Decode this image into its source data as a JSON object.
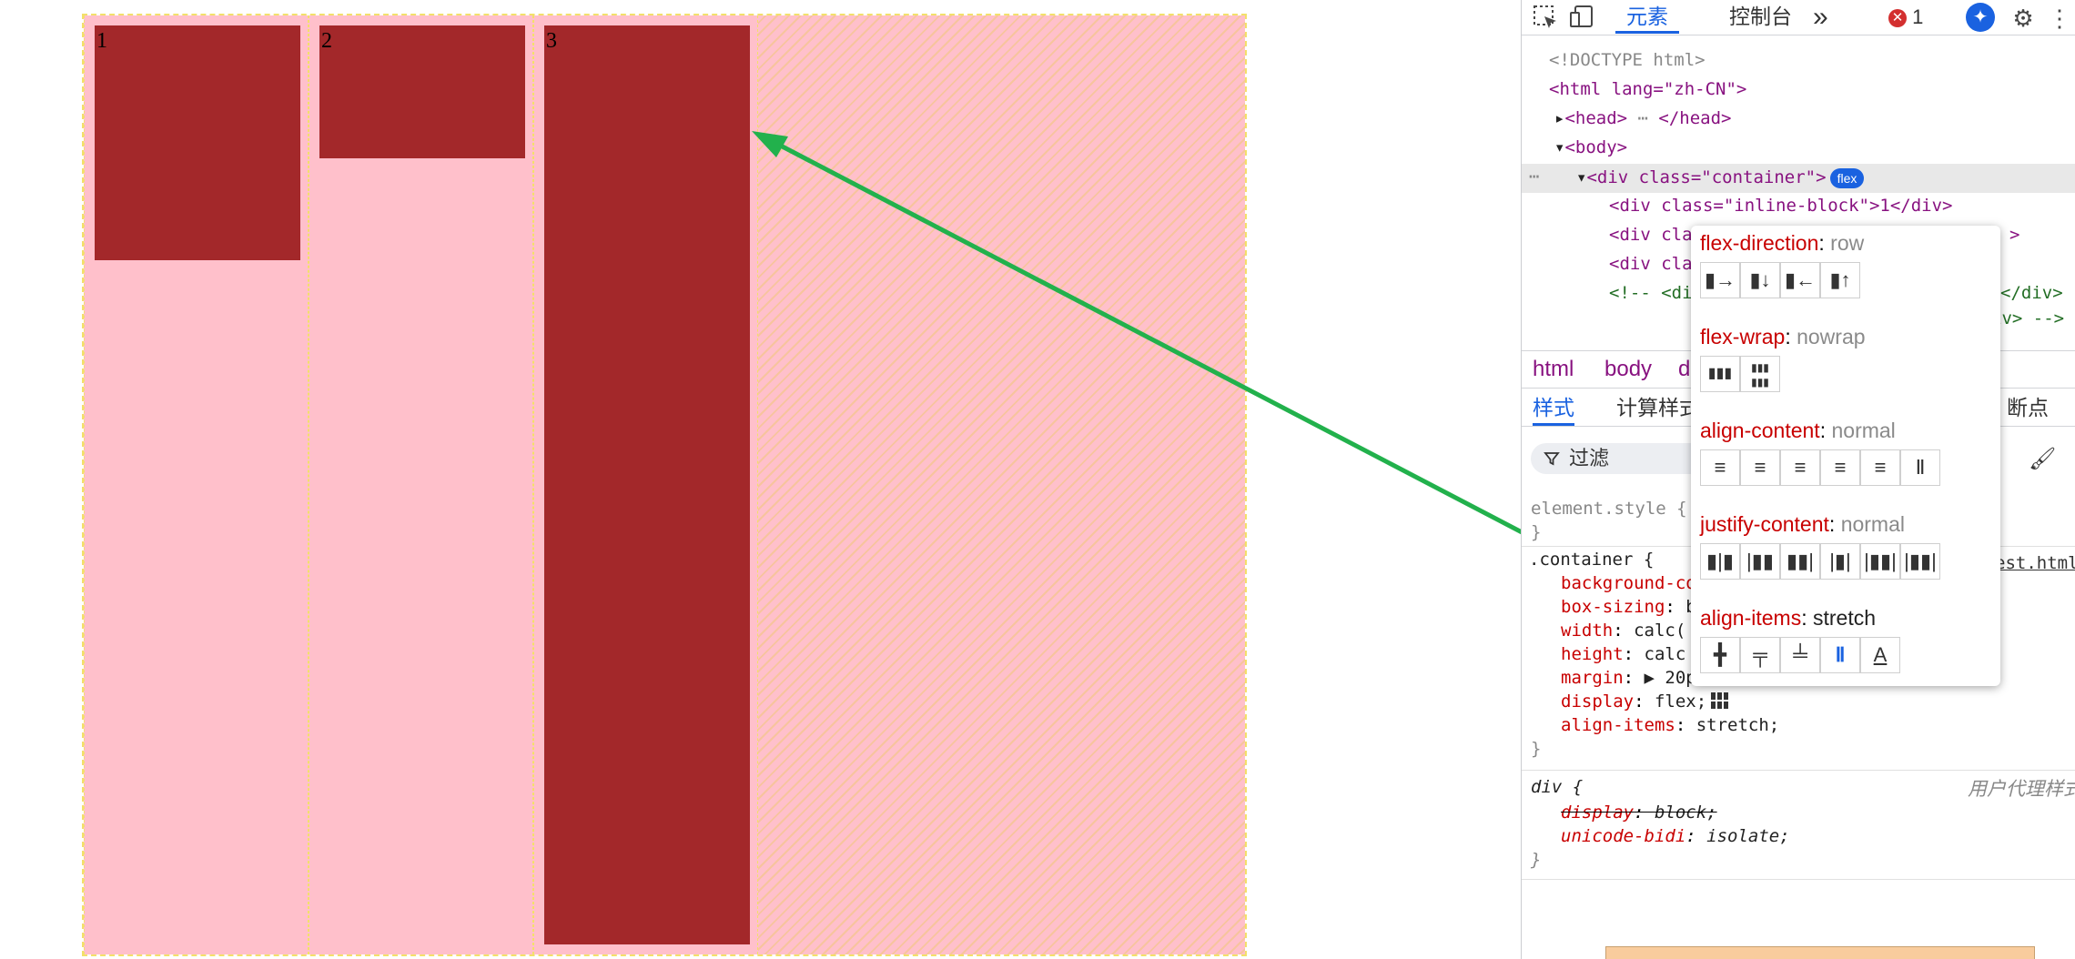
{
  "preview": {
    "items": [
      {
        "label": "1"
      },
      {
        "label": "2"
      },
      {
        "label": "3"
      }
    ],
    "colors": {
      "container_bg": "#ffc0cb",
      "item_bg": "#a3282a",
      "arrow": "#22b14c"
    }
  },
  "devtools": {
    "toolbar": {
      "tabs": [
        "元素",
        "控制台"
      ],
      "active_tab": "元素",
      "more_label": "»",
      "error_count": "1"
    },
    "dom": {
      "doctype": "<!DOCTYPE html>",
      "html_open": "<html lang=\"zh-CN\">",
      "head": "<head>",
      "head_close": "</head>",
      "body": "<body>",
      "container_line": "<div class=\"container\">",
      "flex_badge": "flex",
      "child1": "<div class=\"inline-block\">1</div>",
      "child2": "<div cla",
      "child3": "<div cla",
      "comment": "<!-- <di",
      "close_div_tail": "</div>",
      "comment_tail": "iv> -->",
      "div_close": "</div>",
      "child2_tail": ">"
    },
    "breadcrumbs": [
      "html",
      "body",
      "d"
    ],
    "subtabs": [
      "样式",
      "计算样式",
      "断点"
    ],
    "filter_placeholder": "过滤",
    "styles": {
      "element_style": "element.style {",
      "close_brace": "}",
      "container_selector": ".container {",
      "source_link": "est.html",
      "props": [
        {
          "name": "background-co",
          "value": ""
        },
        {
          "name": "box-sizing",
          "value": "b"
        },
        {
          "name": "width",
          "value": "calc("
        },
        {
          "name": "height",
          "value": "calc"
        },
        {
          "name": "margin",
          "value": "▶ 20p"
        },
        {
          "name": "display",
          "value": "flex;"
        },
        {
          "name": "align-items",
          "value": "stretch;"
        }
      ],
      "ua_selector": "div {",
      "ua_label": "用户代理样式",
      "ua_props": [
        {
          "name": "display",
          "value": "block;"
        },
        {
          "name": "unicode-bidi",
          "value": "isolate;"
        }
      ]
    },
    "flex_editor": {
      "rows": [
        {
          "name": "flex-direction",
          "value": "row",
          "icons": [
            "row-icon",
            "column-icon",
            "row-reverse-icon",
            "column-reverse-icon"
          ],
          "active": -1
        },
        {
          "name": "flex-wrap",
          "value": "nowrap",
          "icons": [
            "nowrap-icon",
            "wrap-icon"
          ],
          "active": -1
        },
        {
          "name": "align-content",
          "value": "normal",
          "icons": [
            "center-icon",
            "flex-start-icon",
            "flex-end-icon",
            "space-around-icon",
            "space-between-icon",
            "stretch-icon"
          ],
          "active": -1
        },
        {
          "name": "justify-content",
          "value": "normal",
          "icons": [
            "center-icon",
            "flex-start-icon",
            "flex-end-icon",
            "space-between-icon",
            "space-around-icon",
            "space-evenly-icon"
          ],
          "active": -1
        },
        {
          "name": "align-items",
          "value": "stretch",
          "icons": [
            "center-icon",
            "flex-start-icon",
            "flex-end-icon",
            "stretch-icon",
            "baseline-icon"
          ],
          "active": 3
        }
      ]
    }
  }
}
